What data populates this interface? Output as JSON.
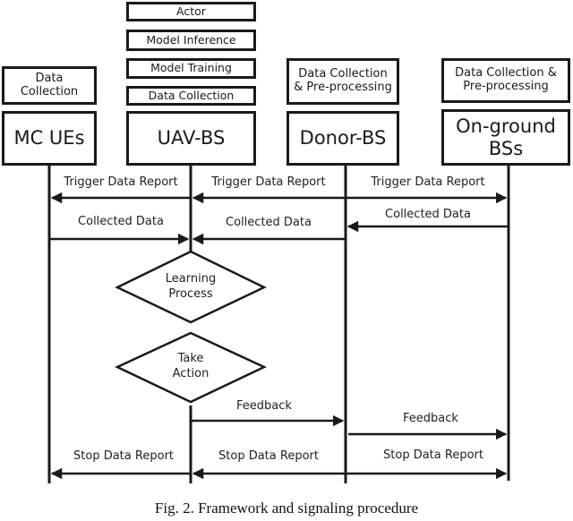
{
  "figure": {
    "caption": "Fig. 2.  Framework and signaling procedure"
  },
  "uav_stack": {
    "actor": "Actor",
    "model_inference": "Model Inference",
    "model_training": "Model Training",
    "data_collection": "Data Collection"
  },
  "role_boxes": {
    "mc_ues": [
      "Data",
      "Collection"
    ],
    "donor_bs": [
      "Data Collection",
      "& Pre-processing"
    ],
    "ground_bss": [
      "Data Collection &",
      "Pre-processing"
    ]
  },
  "entities": {
    "mc_ues": "MC UEs",
    "uav_bs": "UAV-BS",
    "donor_bs": "Donor-BS",
    "ground_bss": [
      "On-ground",
      "BSs"
    ]
  },
  "messages": {
    "trigger_1": "Trigger Data Report",
    "trigger_2": "Trigger Data Report",
    "trigger_3": "Trigger Data Report",
    "collected_1": "Collected Data",
    "collected_2": "Collected Data",
    "collected_3": "Collected Data",
    "feedback_1": "Feedback",
    "feedback_2": "Feedback",
    "stop_1": "Stop Data Report",
    "stop_2": "Stop Data Report",
    "stop_3": "Stop Data Report"
  },
  "decisions": {
    "learning": [
      "Learning",
      "Process"
    ],
    "action": [
      "Take",
      "Action"
    ]
  }
}
